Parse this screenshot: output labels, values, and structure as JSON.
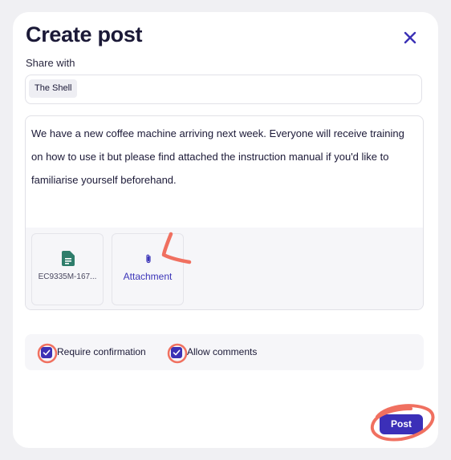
{
  "modal": {
    "title": "Create post",
    "share_label": "Share with",
    "share_chip": "The Shell",
    "message": "We have a new coffee machine arriving next week. Everyone will receive training on how to use it but please find attached the instruction manual if you'd like to familiarise yourself beforehand.",
    "attachments": {
      "file_name": "EC9335M-167...",
      "add_label": "Attachment"
    },
    "options": {
      "require_confirmation": "Require confirmation",
      "allow_comments": "Allow comments"
    },
    "post_label": "Post"
  },
  "colors": {
    "accent": "#3b2fb8",
    "file_icon": "#2e7d6b",
    "annotation": "#f07060"
  },
  "icons": {
    "close": "close-icon",
    "file": "document-icon",
    "attach": "paperclip-icon",
    "check": "check-icon"
  }
}
